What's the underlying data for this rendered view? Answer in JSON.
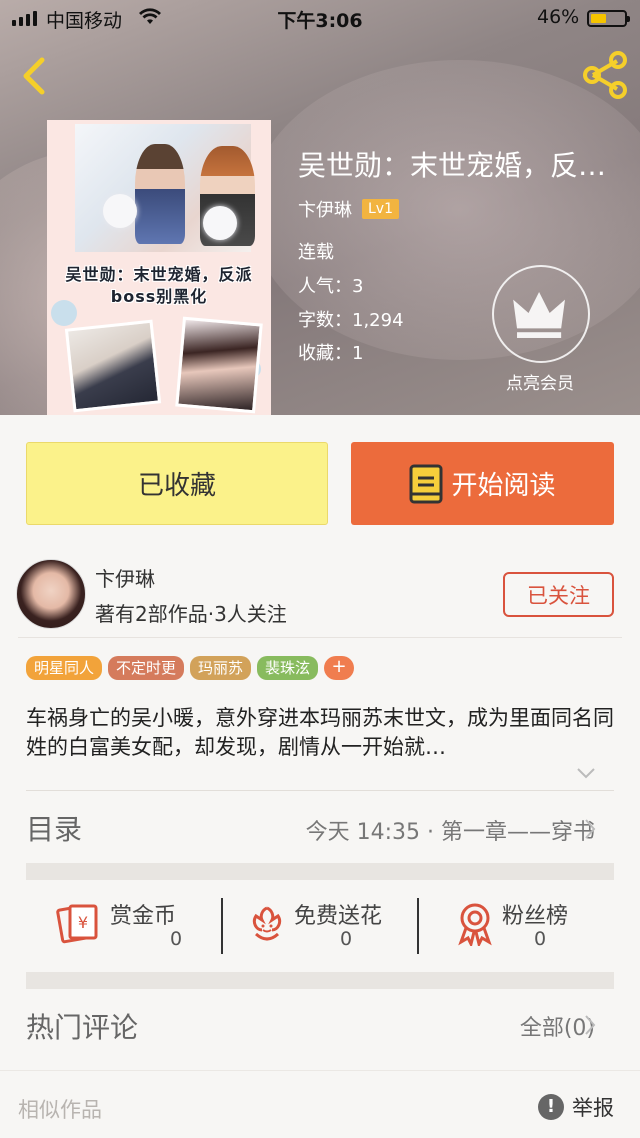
{
  "status_bar": {
    "carrier": "中国移动",
    "time": "下午3:06",
    "battery": "46%",
    "battery_level": 0.46
  },
  "book": {
    "title": "吴世勋：末世宠婚，反派boss别黑化",
    "cover_text": "吴世勋：末世宠婚，反派boss别黑化",
    "author": "卞伊琳",
    "level": "Lv1",
    "status": "连载",
    "popularity_label": "人气：",
    "popularity": "3",
    "words_label": "字数：",
    "words": "1,294",
    "favorites_label": "收藏：",
    "favorites": "1",
    "vip_label": "点亮会员"
  },
  "actions": {
    "favorited": "已收藏",
    "read": "开始阅读"
  },
  "author_card": {
    "name": "卞伊琳",
    "stats": "著有2部作品·3人关注",
    "follow": "已关注"
  },
  "tags": [
    {
      "label": "明星同人",
      "color": "#f2a33a"
    },
    {
      "label": "不定时更",
      "color": "#d57b5c"
    },
    {
      "label": "玛丽苏",
      "color": "#d2a25a"
    },
    {
      "label": "裴珠泫",
      "color": "#88bb5e"
    }
  ],
  "tag_add": "+",
  "description": "车祸身亡的吴小暖，意外穿进本玛丽苏末世文，成为里面同名同姓的白富美女配，却发现，剧情从一开始就…",
  "toc": {
    "label": "目录",
    "latest": "今天 14:35 · 第一章——穿书"
  },
  "stats": [
    {
      "label": "赏金币",
      "count": "0",
      "icon": "coin-card-icon"
    },
    {
      "label": "免费送花",
      "count": "0",
      "icon": "flower-icon"
    },
    {
      "label": "粉丝榜",
      "count": "0",
      "icon": "badge-ribbon-icon"
    }
  ],
  "comments": {
    "label": "热门评论",
    "all": "全部(0)"
  },
  "footer": {
    "similar": "相似作品",
    "report": "举报",
    "report_icon": "!"
  },
  "colors": {
    "accent_orange": "#ec6b3c",
    "favorite_yellow": "#fbf28a",
    "follow_red": "#d9533d"
  }
}
